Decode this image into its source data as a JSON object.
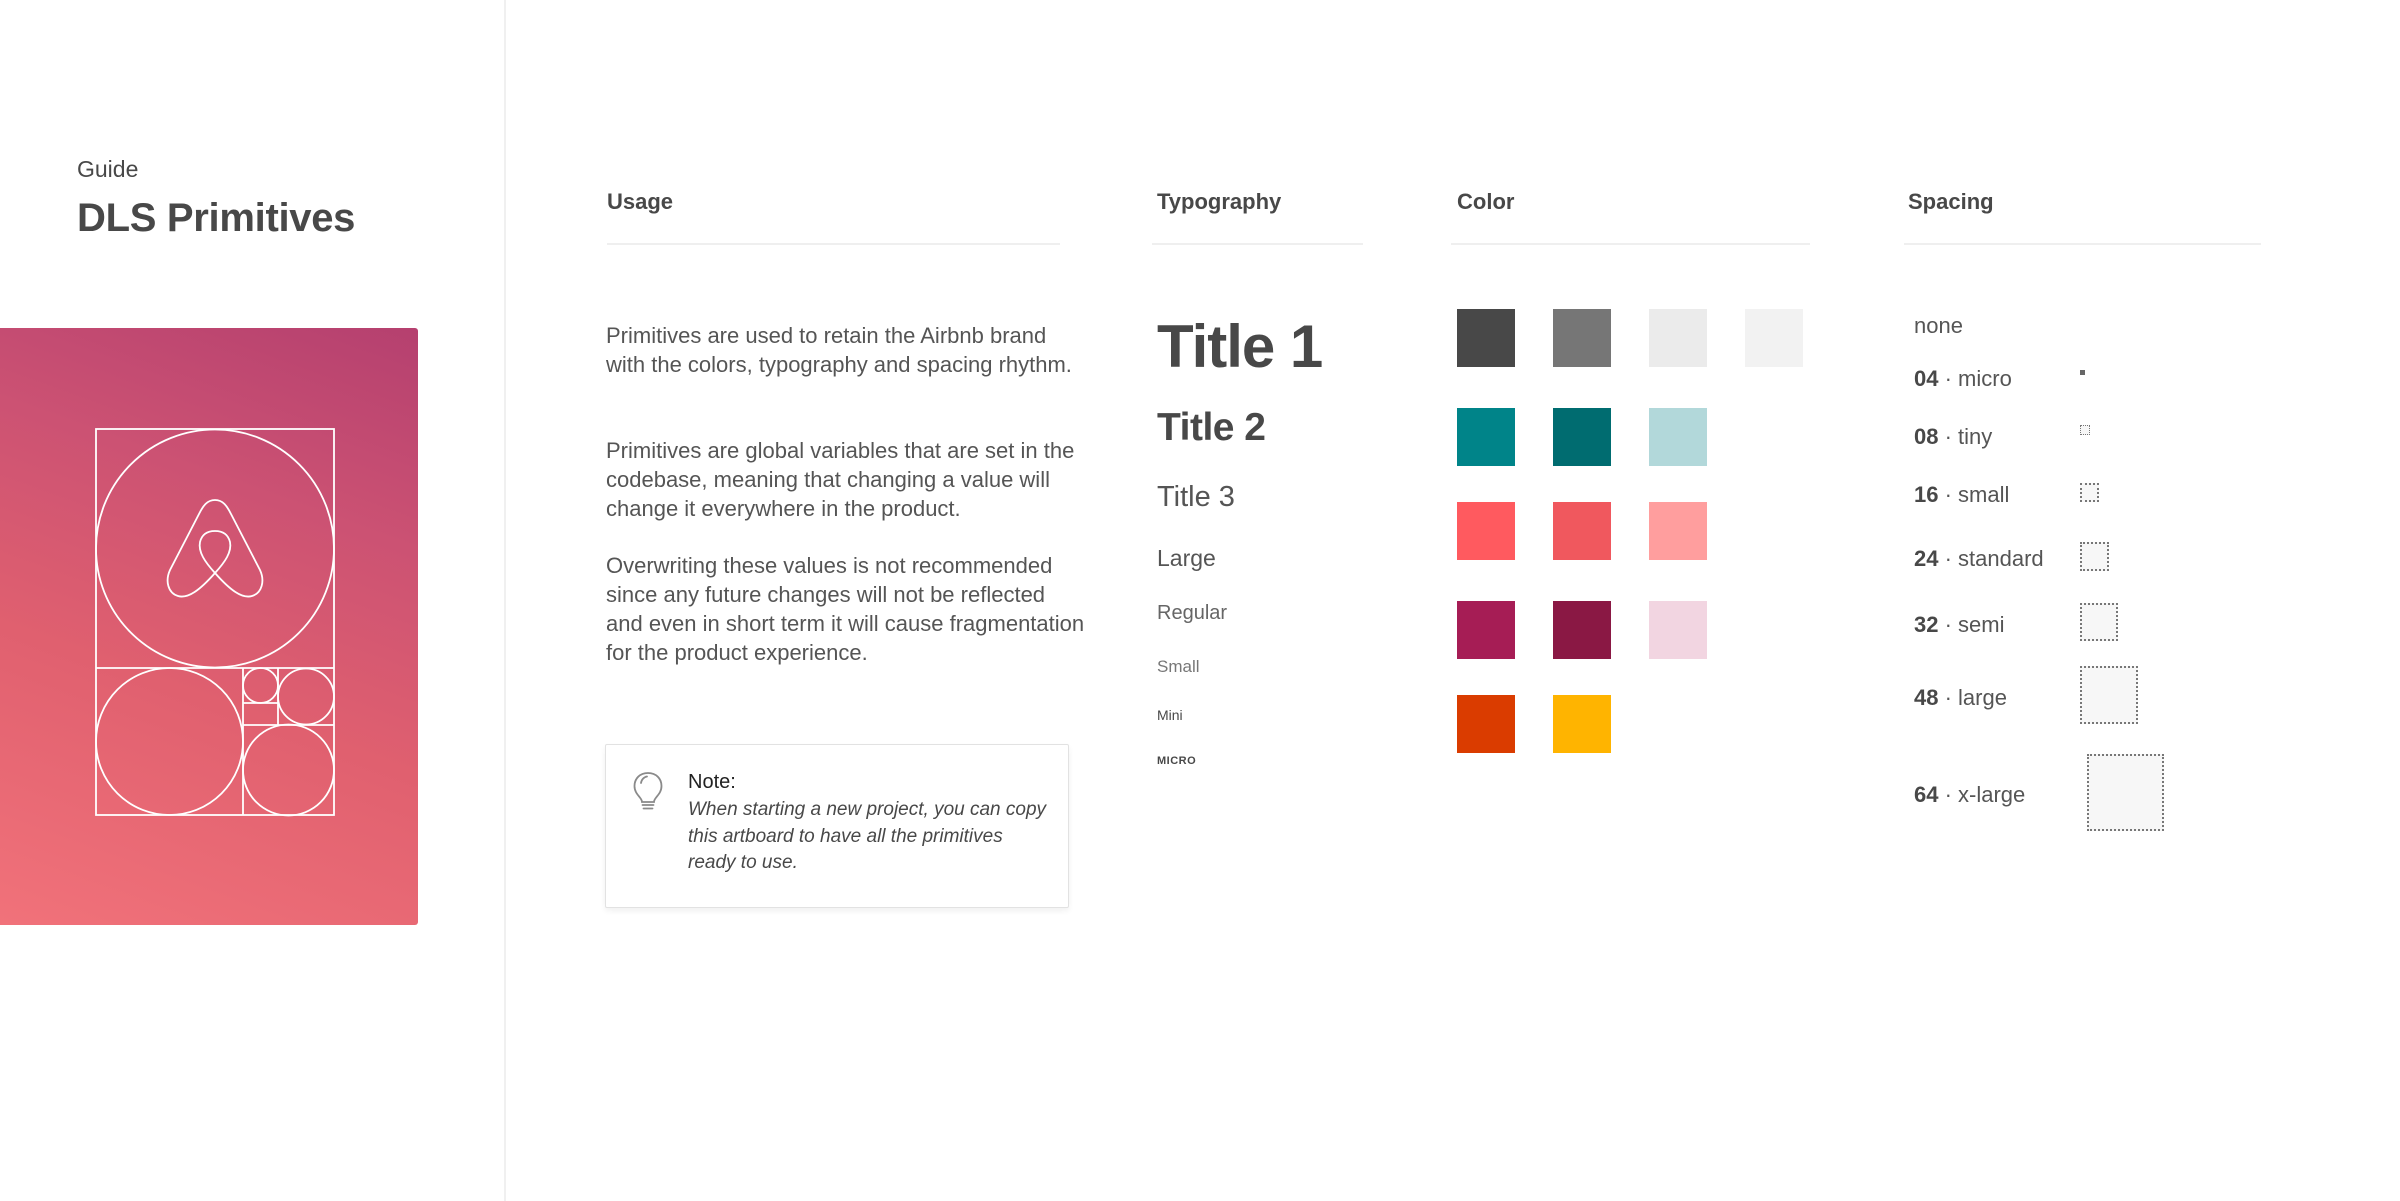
{
  "sidebar": {
    "eyebrow": "Guide",
    "title": "DLS Primitives",
    "hero_gradient": [
      "#f1727a",
      "#b5406f"
    ]
  },
  "usage": {
    "heading": "Usage",
    "paragraphs": [
      "Primitives are used to retain the Airbnb brand with  the colors, typography and spacing rhythm.",
      "Primitives are global variables that are set in the codebase, meaning that changing a value will change it everywhere in the product.",
      "Overwriting these values is not recommended since any future changes will not be reflected and even in short term it will cause fragmentation for the product experience."
    ],
    "note": {
      "icon": "lightbulb-icon",
      "title": "Note:",
      "body": "When starting a new project, you can copy this artboard to have all the primitives ready to use."
    }
  },
  "typography": {
    "heading": "Typography",
    "styles": [
      "Title 1",
      "Title 2",
      "Title 3",
      "Large",
      "Regular",
      "Small",
      "Mini",
      "MICRO"
    ]
  },
  "color": {
    "heading": "Color",
    "rows": [
      [
        "#484848",
        "#767676",
        "#ebebeb",
        "#f2f2f2"
      ],
      [
        "#008489",
        "#006c70",
        "#b2d8da"
      ],
      [
        "#ff5a5f",
        "#f0585e",
        "#ff9e9e"
      ],
      [
        "#a61d55",
        "#8a1844",
        "#f2d5e1"
      ],
      [
        "#da3c00",
        "#ffb400"
      ]
    ]
  },
  "spacing": {
    "heading": "Spacing",
    "items": [
      {
        "value": "",
        "name": "none",
        "size": 0
      },
      {
        "value": "04",
        "name": "micro",
        "size": 4
      },
      {
        "value": "08",
        "name": "tiny",
        "size": 8
      },
      {
        "value": "16",
        "name": "small",
        "size": 16
      },
      {
        "value": "24",
        "name": "standard",
        "size": 24
      },
      {
        "value": "32",
        "name": "semi",
        "size": 32
      },
      {
        "value": "48",
        "name": "large",
        "size": 48
      },
      {
        "value": "64",
        "name": "x-large",
        "size": 64
      }
    ],
    "separator": " · "
  }
}
